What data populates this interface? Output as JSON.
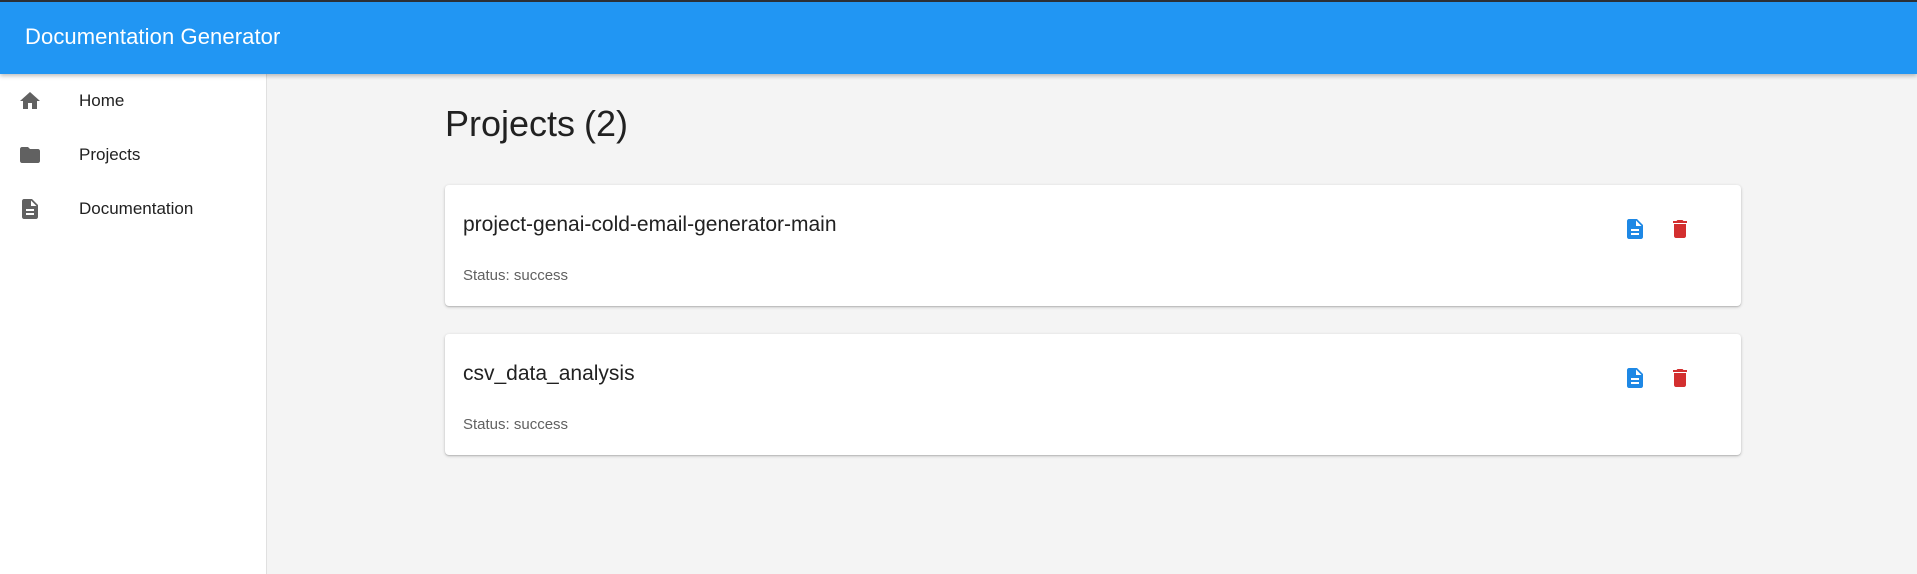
{
  "app": {
    "title": "Documentation Generator"
  },
  "colors": {
    "appbar": "#2196f3",
    "doc_icon": "#1e88e5",
    "delete_icon": "#d32f2f",
    "nav_icon": "#616161"
  },
  "sidebar": {
    "items": [
      {
        "label": "Home",
        "icon": "home-icon"
      },
      {
        "label": "Projects",
        "icon": "folder-icon"
      },
      {
        "label": "Documentation",
        "icon": "description-icon"
      }
    ]
  },
  "main": {
    "heading": "Projects",
    "count": "(2)",
    "projects": [
      {
        "name": "project-genai-cold-email-generator-main",
        "status": "Status: success"
      },
      {
        "name": "csv_data_analysis",
        "status": "Status: success"
      }
    ]
  }
}
